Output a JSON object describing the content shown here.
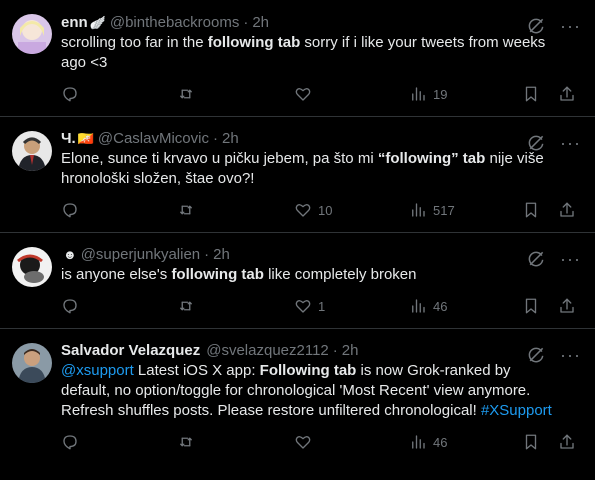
{
  "tweets": [
    {
      "name": "enn",
      "name_emoji": "🪽",
      "handle": "@binthebackrooms",
      "sep": "·",
      "time": "2h",
      "text_parts": [
        {
          "t": "scrolling too far in the ",
          "bold": false
        },
        {
          "t": "following tab",
          "bold": true
        },
        {
          "t": " sorry if i like your tweets from weeks ago <3",
          "bold": false
        }
      ],
      "likes": "",
      "views": "19"
    },
    {
      "name": "Ч.",
      "name_emoji": "🇧🇹",
      "handle": "@CaslavMicovic",
      "sep": "·",
      "time": "2h",
      "text_parts": [
        {
          "t": "Elone, sunce ti krvavo u pičku jebem, pa što mi ",
          "bold": false
        },
        {
          "t": "“following” tab",
          "bold": true
        },
        {
          "t": " nije više hronološki složen, štae ovo?!",
          "bold": false
        }
      ],
      "likes": "10",
      "views": "517"
    },
    {
      "name": "",
      "name_emoji": "☻",
      "handle": "@superjunkyalien",
      "sep": "·",
      "time": "2h",
      "text_parts": [
        {
          "t": "is anyone else's ",
          "bold": false
        },
        {
          "t": "following tab",
          "bold": true
        },
        {
          "t": " like completely broken",
          "bold": false
        }
      ],
      "likes": "1",
      "views": "46"
    },
    {
      "name": "Salvador Velazquez",
      "name_emoji": "",
      "handle": "@svelazquez2112",
      "sep": "·",
      "time": "2h",
      "text_parts": [
        {
          "t": "@xsupport",
          "bold": false,
          "link": true
        },
        {
          "t": " Latest iOS X app: ",
          "bold": false
        },
        {
          "t": "Following tab",
          "bold": true
        },
        {
          "t": " is now Grok-ranked by default, no option/toggle for chronological 'Most Recent' view anymore. Refresh shuffles posts. Please restore unfiltered chronological! ",
          "bold": false
        },
        {
          "t": "#XSupport",
          "bold": false,
          "link": true
        }
      ],
      "likes": "",
      "views": "46"
    }
  ],
  "icons": {
    "grok": "grok-icon",
    "more": "more-icon",
    "reply": "reply-icon",
    "retweet": "retweet-icon",
    "like": "like-icon",
    "views": "views-icon",
    "bookmark": "bookmark-icon",
    "share": "share-icon"
  },
  "more_glyph": "···",
  "colors": {
    "background": "#000000",
    "text": "#e7e9ea",
    "muted": "#71767b",
    "link": "#1d9bf0",
    "divider": "#2f3336"
  }
}
